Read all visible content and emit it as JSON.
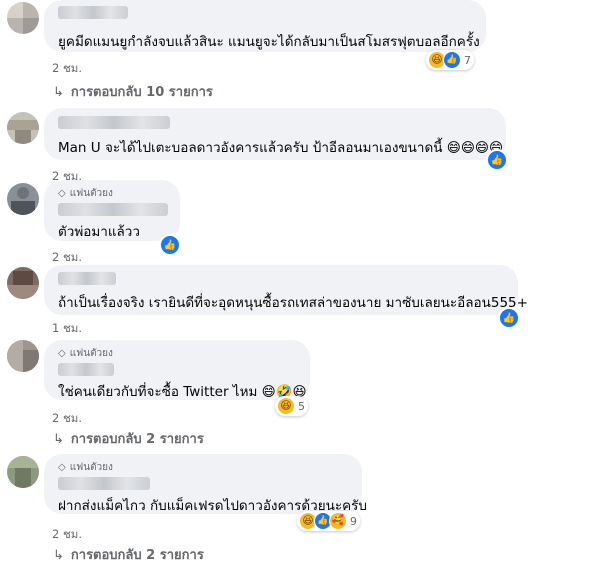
{
  "comments": [
    {
      "text": "ยูคมีดแมนยูกำลังจบแล้วสินะ แมนยูจะได้กลับมาเป็นสโมสรฟุตบอลอีกครั้ง",
      "time": "2 ชม.",
      "reactions": [
        "haha-icon",
        "like-icon"
      ],
      "reaction_count": "7",
      "replies_label": "การตอบกลับ 10 รายการ"
    },
    {
      "text": "Man U จะได้ไปเตะบอลดาวอังคารแล้วครับ ป้าอีลอนมาเองขนาดนี้ 😄😄😄😄",
      "time": "2 ชม."
    },
    {
      "fan_label": "แฟนตัวยง",
      "text": "ตัวพ่อมาแล้วว",
      "time": "2 ชม."
    },
    {
      "text": "ถ้าเป็นเรื่องจริง เรายินดีที่จะอุดหนุนซื้อรถเทสล่าของนาย มาซับเลยนะอีลอน555+",
      "time": "1 ชม."
    },
    {
      "fan_label": "แฟนตัวยง",
      "text": "ใช่คนเดียวกับที่จะซื้อ Twitter ไหม 😄🤣😆",
      "time": "2 ชม.",
      "reactions": [
        "haha-icon"
      ],
      "reaction_count": "5",
      "replies_label": "การตอบกลับ 2 รายการ"
    },
    {
      "fan_label": "แฟนตัวยง",
      "text": "ฝากส่งแม็คไกว กับแม็คเฟรดไปดาวอังคารด้วยนะครับ",
      "time": "2 ชม.",
      "reactions": [
        "haha-icon",
        "like-icon",
        "care-icon"
      ],
      "reaction_count": "9",
      "replies_label": "การตอบกลับ 2 รายการ"
    }
  ],
  "colors": {
    "bubble": "#f0f2f5",
    "meta": "#65676b",
    "like": "#1877f2",
    "haha": "#f7b928"
  }
}
